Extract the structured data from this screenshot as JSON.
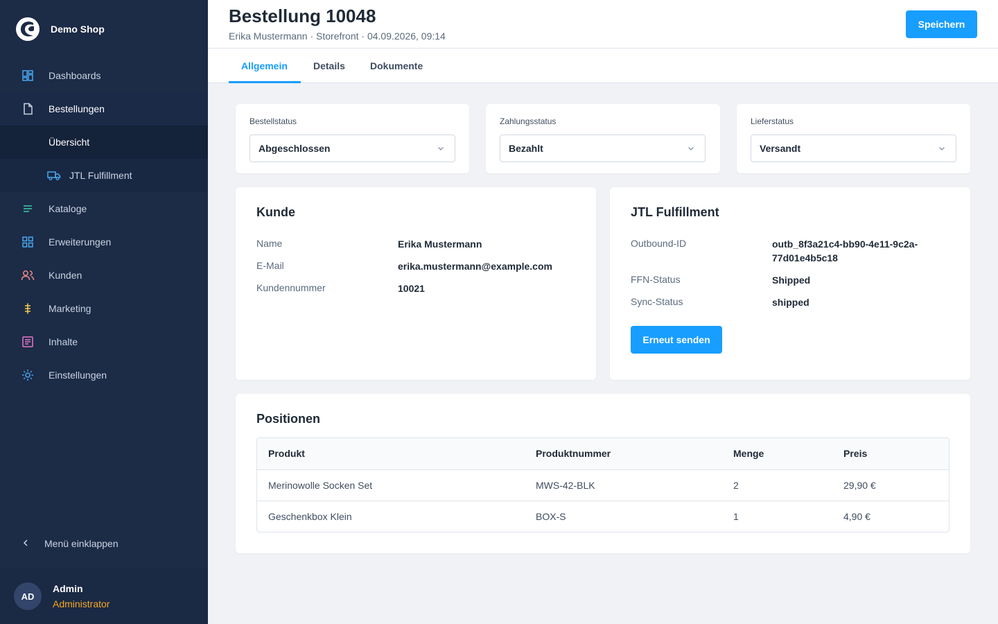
{
  "app": {
    "name": "Demo Shop"
  },
  "sidebar": {
    "items": [
      {
        "label": "Dashboards",
        "icon": "dashboard-icon"
      },
      {
        "label": "Bestellungen",
        "icon": "document-icon"
      },
      {
        "label": "Übersicht"
      },
      {
        "label": "JTL Fulfillment",
        "icon": "truck-icon"
      },
      {
        "label": "Kataloge",
        "icon": "list-icon"
      },
      {
        "label": "Erweiterungen",
        "icon": "grid-icon"
      },
      {
        "label": "Kunden",
        "icon": "users-icon"
      },
      {
        "label": "Marketing",
        "icon": "dollar-icon"
      },
      {
        "label": "Inhalte",
        "icon": "content-icon"
      },
      {
        "label": "Einstellungen",
        "icon": "gear-icon"
      }
    ],
    "collapse_label": "Menü einklappen",
    "user": {
      "initials": "AD",
      "name": "Admin",
      "role": "Administrator"
    }
  },
  "header": {
    "title": "Bestellung 10048",
    "subtitle": "Erika Mustermann · Storefront · 04.09.2026, 09:14",
    "save_label": "Speichern"
  },
  "tabs": [
    {
      "label": "Allgemein",
      "active": true
    },
    {
      "label": "Details",
      "active": false
    },
    {
      "label": "Dokumente",
      "active": false
    }
  ],
  "status": [
    {
      "label": "Bestellstatus",
      "value": "Abgeschlossen"
    },
    {
      "label": "Zahlungsstatus",
      "value": "Bezahlt"
    },
    {
      "label": "Lieferstatus",
      "value": "Versandt"
    }
  ],
  "customer": {
    "title": "Kunde",
    "fields": [
      {
        "label": "Name",
        "value": "Erika Mustermann"
      },
      {
        "label": "E-Mail",
        "value": "erika.mustermann@example.com"
      },
      {
        "label": "Kundennummer",
        "value": "10021"
      }
    ]
  },
  "fulfillment": {
    "title": "JTL Fulfillment",
    "fields": [
      {
        "label": "Outbound-ID",
        "value_line1": "outb_8f3a21c4-bb90-4e11-9c2a-",
        "value_line2": "77d01e4b5c18"
      },
      {
        "label": "FFN-Status",
        "value": "Shipped"
      },
      {
        "label": "Sync-Status",
        "value": "shipped"
      }
    ],
    "resend_label": "Erneut senden"
  },
  "positions": {
    "title": "Positionen",
    "columns": [
      "Produkt",
      "Produktnummer",
      "Menge",
      "Preis"
    ],
    "rows": [
      [
        "Merinowolle Socken Set",
        "MWS-42-BLK",
        "2",
        "29,90 €"
      ],
      [
        "Geschenkbox Klein",
        "BOX-S",
        "1",
        "4,90 €"
      ]
    ]
  },
  "colors": {
    "accent": "#189eff",
    "sidebar": "#1c2b46",
    "role": "#f5a623"
  }
}
